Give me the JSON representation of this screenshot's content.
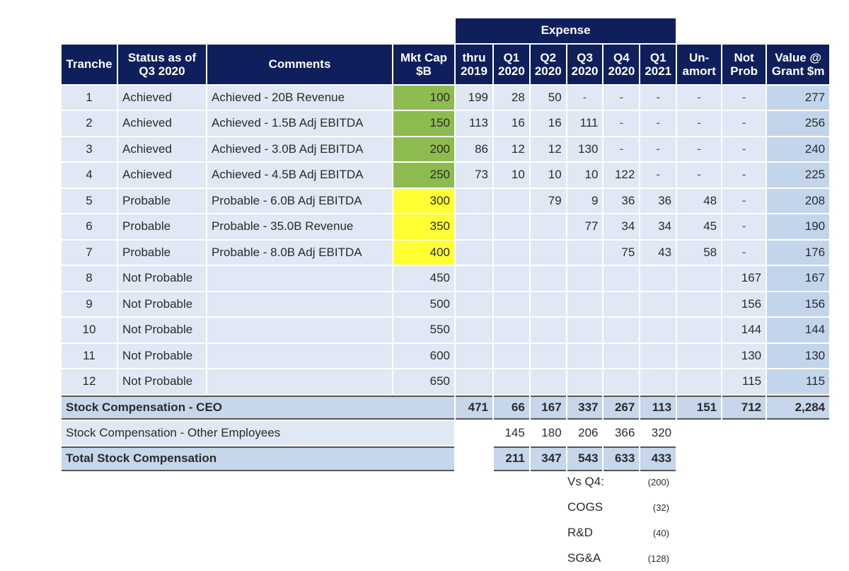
{
  "table": {
    "super_header": "Expense",
    "headers": {
      "tranche": "Tranche",
      "status": "Status as of\nQ3 2020",
      "comments": "Comments",
      "mktcap": "Mkt Cap\n$B",
      "thru2019": "thru\n2019",
      "q1_2020": "Q1\n2020",
      "q2_2020": "Q2\n2020",
      "q3_2020": "Q3\n2020",
      "q4_2020": "Q4\n2020",
      "q1_2021": "Q1\n2021",
      "unamort": "Un-\namort",
      "notprob": "Not\nProb",
      "value": "Value @\nGrant $m"
    },
    "rows": [
      {
        "tranche": "1",
        "status": "Achieved",
        "comment": "Achieved - 20B Revenue",
        "mktcap": "100",
        "mktcap_color": "green",
        "thru2019": "199",
        "q1_2020": "28",
        "q2_2020": "50",
        "q3_2020": "-",
        "q4_2020": "-",
        "q1_2021": "-",
        "unamort": "-",
        "notprob": "-",
        "value": "277"
      },
      {
        "tranche": "2",
        "status": "Achieved",
        "comment": "Achieved - 1.5B Adj EBITDA",
        "mktcap": "150",
        "mktcap_color": "green",
        "thru2019": "113",
        "q1_2020": "16",
        "q2_2020": "16",
        "q3_2020": "111",
        "q4_2020": "-",
        "q1_2021": "-",
        "unamort": "-",
        "notprob": "-",
        "value": "256"
      },
      {
        "tranche": "3",
        "status": "Achieved",
        "comment": "Achieved - 3.0B Adj EBITDA",
        "mktcap": "200",
        "mktcap_color": "green",
        "thru2019": "86",
        "q1_2020": "12",
        "q2_2020": "12",
        "q3_2020": "130",
        "q4_2020": "-",
        "q1_2021": "-",
        "unamort": "-",
        "notprob": "-",
        "value": "240"
      },
      {
        "tranche": "4",
        "status": "Achieved",
        "comment": "Achieved - 4.5B Adj EBITDA",
        "mktcap": "250",
        "mktcap_color": "green",
        "thru2019": "73",
        "q1_2020": "10",
        "q2_2020": "10",
        "q3_2020": "10",
        "q4_2020": "122",
        "q1_2021": "-",
        "unamort": "-",
        "notprob": "-",
        "value": "225"
      },
      {
        "tranche": "5",
        "status": "Probable",
        "comment": "Probable - 6.0B Adj EBITDA",
        "mktcap": "300",
        "mktcap_color": "yellow",
        "thru2019": "",
        "q1_2020": "",
        "q2_2020": "79",
        "q3_2020": "9",
        "q4_2020": "36",
        "q1_2021": "36",
        "unamort": "48",
        "notprob": "-",
        "value": "208"
      },
      {
        "tranche": "6",
        "status": "Probable",
        "comment": "Probable - 35.0B Revenue",
        "mktcap": "350",
        "mktcap_color": "yellow",
        "thru2019": "",
        "q1_2020": "",
        "q2_2020": "",
        "q3_2020": "77",
        "q4_2020": "34",
        "q1_2021": "34",
        "unamort": "45",
        "notprob": "-",
        "value": "190"
      },
      {
        "tranche": "7",
        "status": "Probable",
        "comment": "Probable - 8.0B Adj EBITDA",
        "mktcap": "400",
        "mktcap_color": "yellow",
        "thru2019": "",
        "q1_2020": "",
        "q2_2020": "",
        "q3_2020": "",
        "q4_2020": "75",
        "q1_2021": "43",
        "unamort": "58",
        "notprob": "-",
        "value": "176"
      },
      {
        "tranche": "8",
        "status": "Not Probable",
        "comment": "",
        "mktcap": "450",
        "mktcap_color": "none",
        "thru2019": "",
        "q1_2020": "",
        "q2_2020": "",
        "q3_2020": "",
        "q4_2020": "",
        "q1_2021": "",
        "unamort": "",
        "notprob": "167",
        "value": "167"
      },
      {
        "tranche": "9",
        "status": "Not Probable",
        "comment": "",
        "mktcap": "500",
        "mktcap_color": "none",
        "thru2019": "",
        "q1_2020": "",
        "q2_2020": "",
        "q3_2020": "",
        "q4_2020": "",
        "q1_2021": "",
        "unamort": "",
        "notprob": "156",
        "value": "156"
      },
      {
        "tranche": "10",
        "status": "Not Probable",
        "comment": "",
        "mktcap": "550",
        "mktcap_color": "none",
        "thru2019": "",
        "q1_2020": "",
        "q2_2020": "",
        "q3_2020": "",
        "q4_2020": "",
        "q1_2021": "",
        "unamort": "",
        "notprob": "144",
        "value": "144"
      },
      {
        "tranche": "11",
        "status": "Not Probable",
        "comment": "",
        "mktcap": "600",
        "mktcap_color": "none",
        "thru2019": "",
        "q1_2020": "",
        "q2_2020": "",
        "q3_2020": "",
        "q4_2020": "",
        "q1_2021": "",
        "unamort": "",
        "notprob": "130",
        "value": "130"
      },
      {
        "tranche": "12",
        "status": "Not Probable",
        "comment": "",
        "mktcap": "650",
        "mktcap_color": "none",
        "thru2019": "",
        "q1_2020": "",
        "q2_2020": "",
        "q3_2020": "",
        "q4_2020": "",
        "q1_2021": "",
        "unamort": "",
        "notprob": "115",
        "value": "115"
      }
    ],
    "ceo_total": {
      "label": "Stock Compensation - CEO",
      "thru2019": "471",
      "q1_2020": "66",
      "q2_2020": "167",
      "q3_2020": "337",
      "q4_2020": "267",
      "q1_2021": "113",
      "unamort": "151",
      "notprob": "712",
      "value": "2,284"
    },
    "other_employees": {
      "label": "Stock Compensation - Other Employees",
      "q1_2020": "145",
      "q2_2020": "180",
      "q3_2020": "206",
      "q4_2020": "366",
      "q1_2021": "320"
    },
    "total": {
      "label": "Total Stock Compensation",
      "q1_2020": "211",
      "q2_2020": "347",
      "q3_2020": "543",
      "q4_2020": "633",
      "q1_2021": "433"
    }
  },
  "notes": [
    {
      "label": "Vs Q4:",
      "value": "(200)"
    },
    {
      "label": "COGS",
      "value": "(32)"
    },
    {
      "label": "R&D",
      "value": "(40)"
    },
    {
      "label": "SG&A",
      "value": "(128)"
    }
  ],
  "colors": {
    "header_navy": "#0f1f5c",
    "cell_light": "#dfe8f4",
    "value_col": "#c3d5ea",
    "achieved_green": "#8dbb4f",
    "probable_yellow": "#ffff33"
  }
}
